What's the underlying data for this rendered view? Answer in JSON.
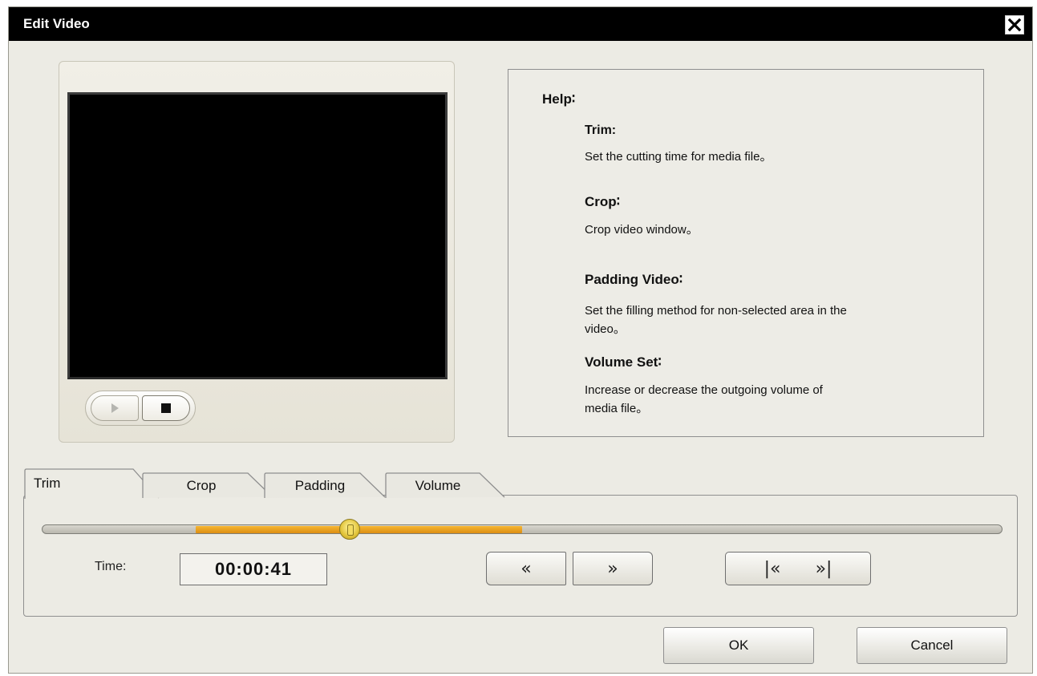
{
  "window": {
    "title": "Edit Video"
  },
  "help": {
    "heading": "Help∶",
    "sections": [
      {
        "title": "Trim:",
        "text": "Set the cutting time for media file。"
      },
      {
        "title": "Crop∶",
        "text": "Crop video window。"
      },
      {
        "title": "Padding Video∶",
        "text_line1": "Set the filling method for non-selected area in the",
        "text_line2": "video。"
      },
      {
        "title": "Volume Set∶",
        "text_line1": "Increase or decrease the outgoing volume of",
        "text_line2": "media file。"
      }
    ]
  },
  "tabs": [
    {
      "label": "Trim",
      "active": true
    },
    {
      "label": "Crop",
      "active": false
    },
    {
      "label": "Padding",
      "active": false
    },
    {
      "label": "Volume",
      "active": false
    }
  ],
  "trim": {
    "time_label": "Time:",
    "time_value": "00:00:41",
    "selected_range_start_fraction": 0.16,
    "selected_range_end_fraction": 0.5,
    "playhead_fraction": 0.32,
    "prev_label": "«",
    "next_label": "»",
    "jump_start_label": "|«",
    "jump_end_label": "»|"
  },
  "buttons": {
    "ok": "OK",
    "cancel": "Cancel"
  },
  "colors": {
    "titlebar": "#000000",
    "dialog_bg": "#ecebe4",
    "range": "#e9a020",
    "thumb": "#e6c83c"
  },
  "icons": [
    "close-icon",
    "play-icon",
    "stop-icon"
  ]
}
